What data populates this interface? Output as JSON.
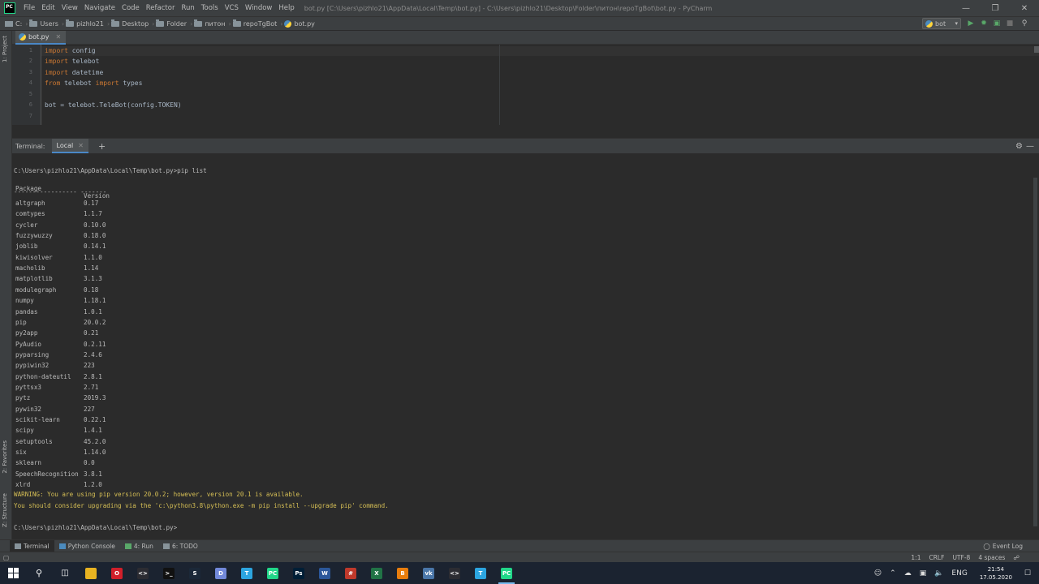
{
  "titlebar": {
    "menu": [
      "File",
      "Edit",
      "View",
      "Navigate",
      "Code",
      "Refactor",
      "Run",
      "Tools",
      "VCS",
      "Window",
      "Help"
    ],
    "window_title": "bot.py [C:\\Users\\pizhlo21\\AppData\\Local\\Temp\\bot.py] - C:\\Users\\pizhlo21\\Desktop\\Folder\\питон\\repoTgBot\\bot.py - PyCharm"
  },
  "navbar": {
    "crumbs": [
      "C:",
      "Users",
      "pizhlo21",
      "Desktop",
      "Folder",
      "питон",
      "repoTgBot",
      "bot.py"
    ],
    "run_config": "bot"
  },
  "left_stripe": {
    "project": "1: Project",
    "favorites": "2: Favorites",
    "structure": "Z: Structure"
  },
  "editor": {
    "tab_label": "bot.py",
    "line_numbers": [
      "1",
      "2",
      "3",
      "4",
      "5",
      "6",
      "7"
    ],
    "lines": [
      {
        "kw": "import",
        "rest": " config"
      },
      {
        "kw": "import",
        "rest": " telebot"
      },
      {
        "kw": "import",
        "rest": " datetime"
      },
      {
        "kw": "from",
        "rest": " telebot ",
        "kw2": "import",
        "rest2": " types"
      },
      {
        "kw": "",
        "rest": ""
      },
      {
        "kw": "",
        "rest": "bot = telebot.TeleBot(config.TOKEN)"
      },
      {
        "kw": "",
        "rest": ""
      }
    ]
  },
  "terminal": {
    "title": "Terminal:",
    "tab_label": "Local",
    "command": "C:\\Users\\pizhlo21\\AppData\\Local\\Temp\\bot.py>pip list",
    "header_package": "Package",
    "header_version": "Version",
    "header_rule": "----------------- -------",
    "packages": [
      [
        "altgraph",
        "0.17"
      ],
      [
        "comtypes",
        "1.1.7"
      ],
      [
        "cycler",
        "0.10.0"
      ],
      [
        "fuzzywuzzy",
        "0.18.0"
      ],
      [
        "joblib",
        "0.14.1"
      ],
      [
        "kiwisolver",
        "1.1.0"
      ],
      [
        "macholib",
        "1.14"
      ],
      [
        "matplotlib",
        "3.1.3"
      ],
      [
        "modulegraph",
        "0.18"
      ],
      [
        "numpy",
        "1.18.1"
      ],
      [
        "pandas",
        "1.0.1"
      ],
      [
        "pip",
        "20.0.2"
      ],
      [
        "py2app",
        "0.21"
      ],
      [
        "PyAudio",
        "0.2.11"
      ],
      [
        "pyparsing",
        "2.4.6"
      ],
      [
        "pypiwin32",
        "223"
      ],
      [
        "python-dateutil",
        "2.8.1"
      ],
      [
        "pyttsx3",
        "2.71"
      ],
      [
        "pytz",
        "2019.3"
      ],
      [
        "pywin32",
        "227"
      ],
      [
        "scikit-learn",
        "0.22.1"
      ],
      [
        "scipy",
        "1.4.1"
      ],
      [
        "setuptools",
        "45.2.0"
      ],
      [
        "six",
        "1.14.0"
      ],
      [
        "sklearn",
        "0.0"
      ],
      [
        "SpeechRecognition",
        "3.8.1"
      ],
      [
        "xlrd",
        "1.2.0"
      ]
    ],
    "warning_1": "WARNING: You are using pip version 20.0.2; however, version 20.1 is available.",
    "warning_2": "You should consider upgrading via the 'c:\\python3.8\\python.exe -m pip install --upgrade pip' command.",
    "prompt": "C:\\Users\\pizhlo21\\AppData\\Local\\Temp\\bot.py>"
  },
  "tool_buttons": {
    "terminal": "Terminal",
    "python_console": "Python Console",
    "run": "4: Run",
    "todo": "6: TODO",
    "event_log": "Event Log"
  },
  "statusbar": {
    "position": "1:1",
    "line_sep": "CRLF",
    "encoding": "UTF-8",
    "indent": "4 spaces"
  },
  "taskbar": {
    "lang": "ENG",
    "time": "21:54",
    "date": "17.05.2020",
    "apps": [
      {
        "name": "file-explorer-icon",
        "color": "#e8b321",
        "label": ""
      },
      {
        "name": "opera-icon",
        "color": "#d11f2a",
        "label": "O"
      },
      {
        "name": "vscode-icon",
        "color": "#2c2c32",
        "label": "<>"
      },
      {
        "name": "cmd-icon",
        "color": "#111111",
        "label": ">_"
      },
      {
        "name": "steam-icon",
        "color": "#1b2838",
        "label": "S"
      },
      {
        "name": "discord-icon",
        "color": "#7289da",
        "label": "D"
      },
      {
        "name": "telegram-icon",
        "color": "#2ca5e0",
        "label": "T"
      },
      {
        "name": "pycharm-icon",
        "color": "#21d789",
        "label": "PC"
      },
      {
        "name": "photoshop-icon",
        "color": "#001e36",
        "label": "Ps"
      },
      {
        "name": "word-icon",
        "color": "#2b579a",
        "label": "W"
      },
      {
        "name": "chess-icon",
        "color": "#c0392b",
        "label": "#"
      },
      {
        "name": "excel-icon",
        "color": "#217346",
        "label": "X"
      },
      {
        "name": "blender-icon",
        "color": "#e87d0d",
        "label": "B"
      },
      {
        "name": "vk-icon",
        "color": "#4a76a8",
        "label": "vk"
      },
      {
        "name": "vscode-icon-2",
        "color": "#2c2c32",
        "label": "<>"
      },
      {
        "name": "telegram-icon-2",
        "color": "#2ca5e0",
        "label": "T"
      },
      {
        "name": "pycharm-icon-2",
        "color": "#21d789",
        "label": "PC"
      }
    ]
  }
}
